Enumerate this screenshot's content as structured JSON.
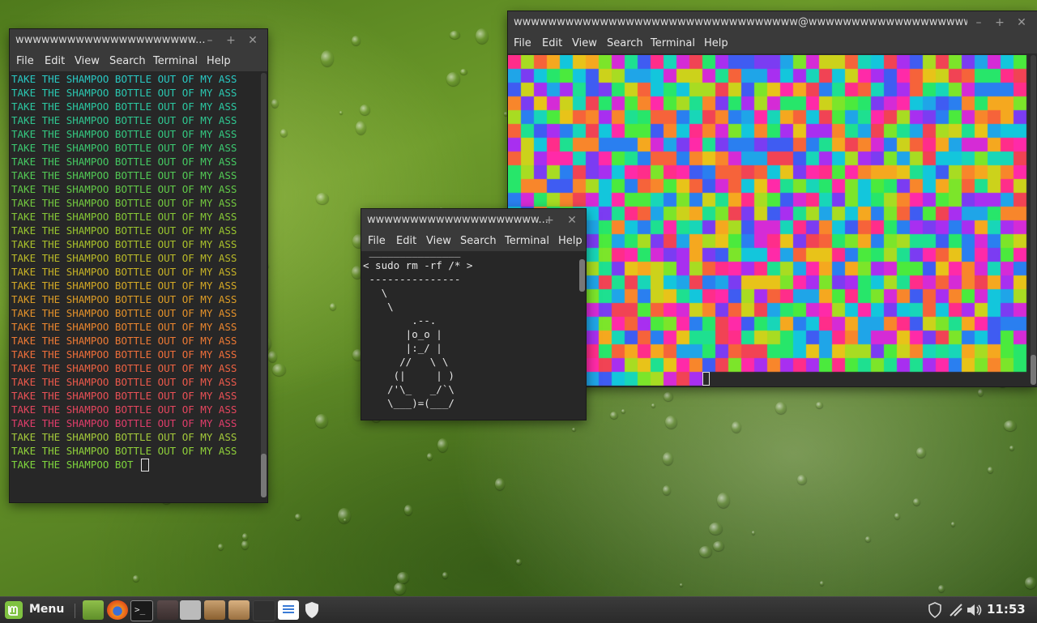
{
  "windows": {
    "left": {
      "title": "wwwwwwwwwwwwwwwwwwwww...",
      "lines": [
        {
          "text": "TAKE THE SHAMPOO BOTTLE OUT OF MY ASS",
          "color": "#29c8c3"
        },
        {
          "text": "TAKE THE SHAMPOO BOTTLE OUT OF MY ASS",
          "color": "#2ac7b0"
        },
        {
          "text": "TAKE THE SHAMPOO BOTTLE OUT OF MY ASS",
          "color": "#2bc6a0"
        },
        {
          "text": "TAKE THE SHAMPOO BOTTLE OUT OF MY ASS",
          "color": "#2fc690"
        },
        {
          "text": "TAKE THE SHAMPOO BOTTLE OUT OF MY ASS",
          "color": "#34c780"
        },
        {
          "text": "TAKE THE SHAMPOO BOTTLE OUT OF MY ASS",
          "color": "#3bc870"
        },
        {
          "text": "TAKE THE SHAMPOO BOTTLE OUT OF MY ASS",
          "color": "#45c962"
        },
        {
          "text": "TAKE THE SHAMPOO BOTTLE OUT OF MY ASS",
          "color": "#52c955"
        },
        {
          "text": "TAKE THE SHAMPOO BOTTLE OUT OF MY ASS",
          "color": "#62ca48"
        },
        {
          "text": "TAKE THE SHAMPOO BOTTLE OUT OF MY ASS",
          "color": "#73c93f"
        },
        {
          "text": "TAKE THE SHAMPOO BOTTLE OUT OF MY ASS",
          "color": "#85c736"
        },
        {
          "text": "TAKE THE SHAMPOO BOTTLE OUT OF MY ASS",
          "color": "#98c42f"
        },
        {
          "text": "TAKE THE SHAMPOO BOTTLE OUT OF MY ASS",
          "color": "#a9c02b"
        },
        {
          "text": "TAKE THE SHAMPOO BOTTLE OUT OF MY ASS",
          "color": "#b9ba28"
        },
        {
          "text": "TAKE THE SHAMPOO BOTTLE OUT OF MY ASS",
          "color": "#c7b226"
        },
        {
          "text": "TAKE THE SHAMPOO BOTTLE OUT OF MY ASS",
          "color": "#d3a825"
        },
        {
          "text": "TAKE THE SHAMPOO BOTTLE OUT OF MY ASS",
          "color": "#dd9d27"
        },
        {
          "text": "TAKE THE SHAMPOO BOTTLE OUT OF MY ASS",
          "color": "#e4912a"
        },
        {
          "text": "TAKE THE SHAMPOO BOTTLE OUT OF MY ASS",
          "color": "#e9852e"
        },
        {
          "text": "TAKE THE SHAMPOO BOTTLE OUT OF MY ASS",
          "color": "#ec7934"
        },
        {
          "text": "TAKE THE SHAMPOO BOTTLE OUT OF MY ASS",
          "color": "#ee6e3a"
        },
        {
          "text": "TAKE THE SHAMPOO BOTTLE OUT OF MY ASS",
          "color": "#ee6342"
        },
        {
          "text": "TAKE THE SHAMPOO BOTTLE OUT OF MY ASS",
          "color": "#ec594b"
        },
        {
          "text": "TAKE THE SHAMPOO BOTTLE OUT OF MY ASS",
          "color": "#e85055"
        },
        {
          "text": "TAKE THE SHAMPOO BOTTLE OUT OF MY ASS",
          "color": "#e4465e"
        },
        {
          "text": "TAKE THE SHAMPOO BOTTLE OUT OF MY ASS",
          "color": "#df3d6a"
        },
        {
          "text": "TAKE THE SHAMPOO BOTTLE OUT OF MY ASS",
          "color": "#a3c83a"
        },
        {
          "text": "TAKE THE SHAMPOO BOTTLE OUT OF MY ASS",
          "color": "#8fd03a"
        },
        {
          "text": "TAKE THE SHAMPOO BOT",
          "color": "#7ed43d"
        }
      ]
    },
    "middle": {
      "title": "wwwwwwwwwwwwwwwwwwww...",
      "art_lines": [
        " _______________",
        "< sudo rm -rf /* >",
        " ---------------",
        "   \\",
        "    \\",
        "        .--.",
        "       |o_o |",
        "       |:_/ |",
        "      //   \\ \\",
        "     (|     | )",
        "    /'\\_   _/`\\",
        "    \\___)=(___/"
      ]
    },
    "right": {
      "title": "wwwwwwwwwwwwwwwwwwwwwwwwwwwwwwwww@wwwwwwwwwwwwwwwwwwwwwwwww..."
    }
  },
  "menu_items": [
    "File",
    "Edit",
    "View",
    "Search",
    "Terminal",
    "Help"
  ],
  "pixel_palette": [
    "#ff2d8a",
    "#ff2aa8",
    "#d52bd6",
    "#a82ff0",
    "#7b3cf2",
    "#3f5cf2",
    "#2a7ff0",
    "#1fa5e8",
    "#13c6dc",
    "#18d6b8",
    "#1ee090",
    "#27e66a",
    "#4bea3d",
    "#7ce52a",
    "#a8dc22",
    "#ccd21b",
    "#e8c319",
    "#f5a81f",
    "#f8862b",
    "#f6633a",
    "#f14354"
  ],
  "taskbar": {
    "menu_label": "Menu",
    "clock": "11:53"
  }
}
